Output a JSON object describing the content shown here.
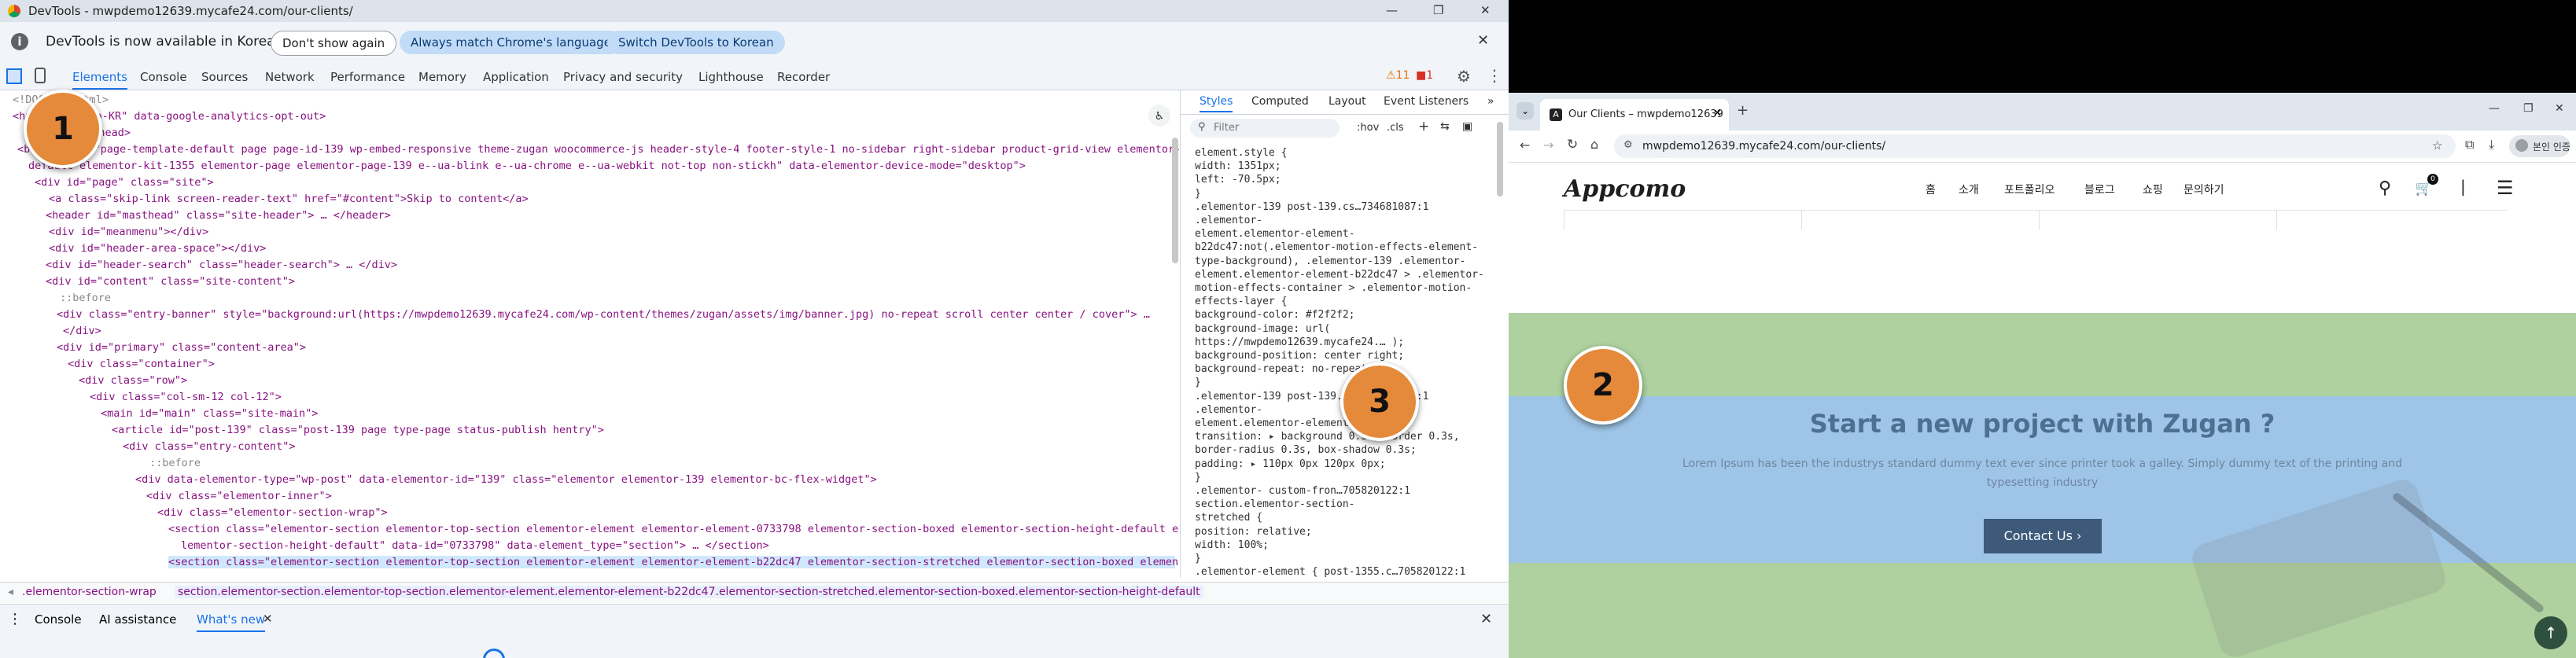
{
  "devtools": {
    "window_title": "DevTools - mwpdemo12639.mycafe24.com/our-clients/",
    "infobar": {
      "message": "DevTools is now available in Korean",
      "dont_show": "Don't show again",
      "match_language": "Always match Chrome's language",
      "switch_language": "Switch DevTools to Korean"
    },
    "tabs": [
      "Elements",
      "Console",
      "Sources",
      "Network",
      "Performance",
      "Memory",
      "Application",
      "Privacy and security",
      "Lighthouse",
      "Recorder"
    ],
    "warnings_count": "11",
    "errors_count": "1",
    "dom_lines": [
      "<!DOCTYPE html>",
      "<html lang=\"ko-KR\" data-google-analytics-opt-out>",
      "<head> … </head>",
      "<body class=\"page-template-default page page-id-139 wp-embed-responsive theme-zugan woocommerce-js header-style-4 footer-style-1 no-sidebar right-sidebar product-grid-view elementor-",
      "default elementor-kit-1355 elementor-page elementor-page-139 e--ua-blink e--ua-chrome e--ua-webkit not-top non-stickh\" data-elementor-device-mode=\"desktop\">",
      "<div id=\"page\" class=\"site\">",
      "<a class=\"skip-link screen-reader-text\" href=\"#content\">Skip to content</a>",
      "<header id=\"masthead\" class=\"site-header\"> … </header>",
      "<div id=\"meanmenu\"></div>",
      "<div id=\"header-area-space\"></div>",
      "<div id=\"header-search\" class=\"header-search\"> … </div>",
      "<div id=\"content\" class=\"site-content\">",
      "::before",
      "<div class=\"entry-banner\" style=\"background:url(https://mwpdemo12639.mycafe24.com/wp-content/themes/zugan/assets/img/banner.jpg) no-repeat scroll center center / cover\"> …",
      "</div>",
      "<div id=\"primary\" class=\"content-area\">",
      "<div class=\"container\">",
      "<div class=\"row\">",
      "<div class=\"col-sm-12 col-12\">",
      "<main id=\"main\" class=\"site-main\">",
      "<article id=\"post-139\" class=\"post-139 page type-page status-publish hentry\">",
      "<div class=\"entry-content\">",
      "::before",
      "<div data-elementor-type=\"wp-post\" data-elementor-id=\"139\" class=\"elementor elementor-139 elementor-bc-flex-widget\">",
      "<div class=\"elementor-inner\">",
      "<div class=\"elementor-section-wrap\">",
      "<section class=\"elementor-section elementor-top-section elementor-element elementor-element-0733798 elementor-section-boxed elementor-section-height-default e",
      "lementor-section-height-default\" data-id=\"0733798\" data-element_type=\"section\"> … </section>",
      "<section class=\"elementor-section elementor-top-section elementor-element elementor-element-b22dc47 elementor-section-stretched elementor-section-boxed elemen"
    ],
    "styles_tabs": [
      "Styles",
      "Computed",
      "Layout",
      "Event Listeners"
    ],
    "filter_placeholder": "Filter",
    "filter_hov": ":hov",
    "filter_cls": ".cls",
    "style_lines": [
      "element.style {",
      "  width: 1351px;",
      "  left: -70.5px;",
      "}",
      ".elementor-139          post-139.cs…734681087:1",
      ".elementor-",
      "element.elementor-element-",
      "b22dc47:not(.elementor-motion-effects-element-",
      "type-background), .elementor-139 .elementor-",
      "element.elementor-element-b22dc47 > .elementor-",
      "motion-effects-container > .elementor-motion-",
      "effects-layer {",
      "  background-color: #f2f2f2;",
      "  background-image: url(",
      "    https://mwpdemo12639.mycafe24.… );",
      "  background-position: center right;",
      "  background-repeat: no-repeat;",
      "}",
      ".elementor-139          post-139.cs…734681087:1",
      ".elementor-",
      "element.elementor-element-b22dc47 {",
      "  transition: ▸ background 0.3s, border 0.3s,",
      "    border-radius 0.3s, box-shadow 0.3s;",
      "  padding: ▸ 110px 0px 120px 0px;",
      "}",
      ".elementor-          custom-fron…705820122:1",
      "section.elementor-section-",
      "stretched {",
      "  position: relative;",
      "  width: 100%;",
      "}",
      ".elementor-element {   post-1355.c…705820122:1"
    ],
    "breadcrumb": [
      ".elementor-section-wrap",
      "section.elementor-section.elementor-top-section.elementor-element.elementor-element-b22dc47.elementor-section-stretched.elementor-section-boxed.elementor-section-height-default"
    ],
    "drawer_tabs": [
      "Console",
      "AI assistance",
      "What's new"
    ]
  },
  "browser": {
    "tab_title": "Our Clients – mwpdemo12639",
    "url": "mwpdemo12639.mycafe24.com/our-clients/",
    "profile_label": "본인 인증",
    "site": {
      "logo": "Appcomo",
      "nav": [
        "홈",
        "소개",
        "포트폴리오",
        "블로그",
        "쇼핑",
        "문의하기"
      ],
      "cart_count": "0",
      "cta_heading": "Start a new project with Zugan ?",
      "cta_text_line1": "Lorem Ipsum has been the industrys standard dummy text ever since printer took a galley. Simply dummy text of the printing and",
      "cta_text_line2": "typesetting industry",
      "cta_button": "Contact Us"
    }
  },
  "annotations": [
    "1",
    "2",
    "3"
  ],
  "colors": {
    "accent_blue": "#1a73e8",
    "annotation_orange": "#e48a3a",
    "cta_button": "#3d5a7a",
    "highlight_green": "#aed19f",
    "highlight_blue": "#9ec5e8"
  }
}
